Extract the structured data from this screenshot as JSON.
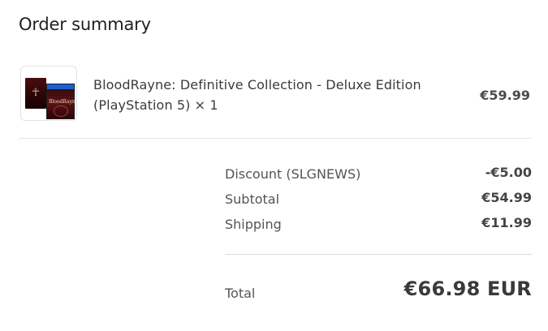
{
  "title": "Order summary",
  "product": {
    "name": "BloodRayne: Definitive Collection - Deluxe Edition (PlayStation 5) × 1",
    "price": "€59.99",
    "image_icon": "game-case-thumbnail"
  },
  "summary": {
    "discount": {
      "label": "Discount (SLGNEWS)",
      "value": "-€5.00"
    },
    "subtotal": {
      "label": "Subtotal",
      "value": "€54.99"
    },
    "shipping": {
      "label": "Shipping",
      "value": "€11.99"
    }
  },
  "total": {
    "label": "Total",
    "value": "€66.98 EUR"
  }
}
